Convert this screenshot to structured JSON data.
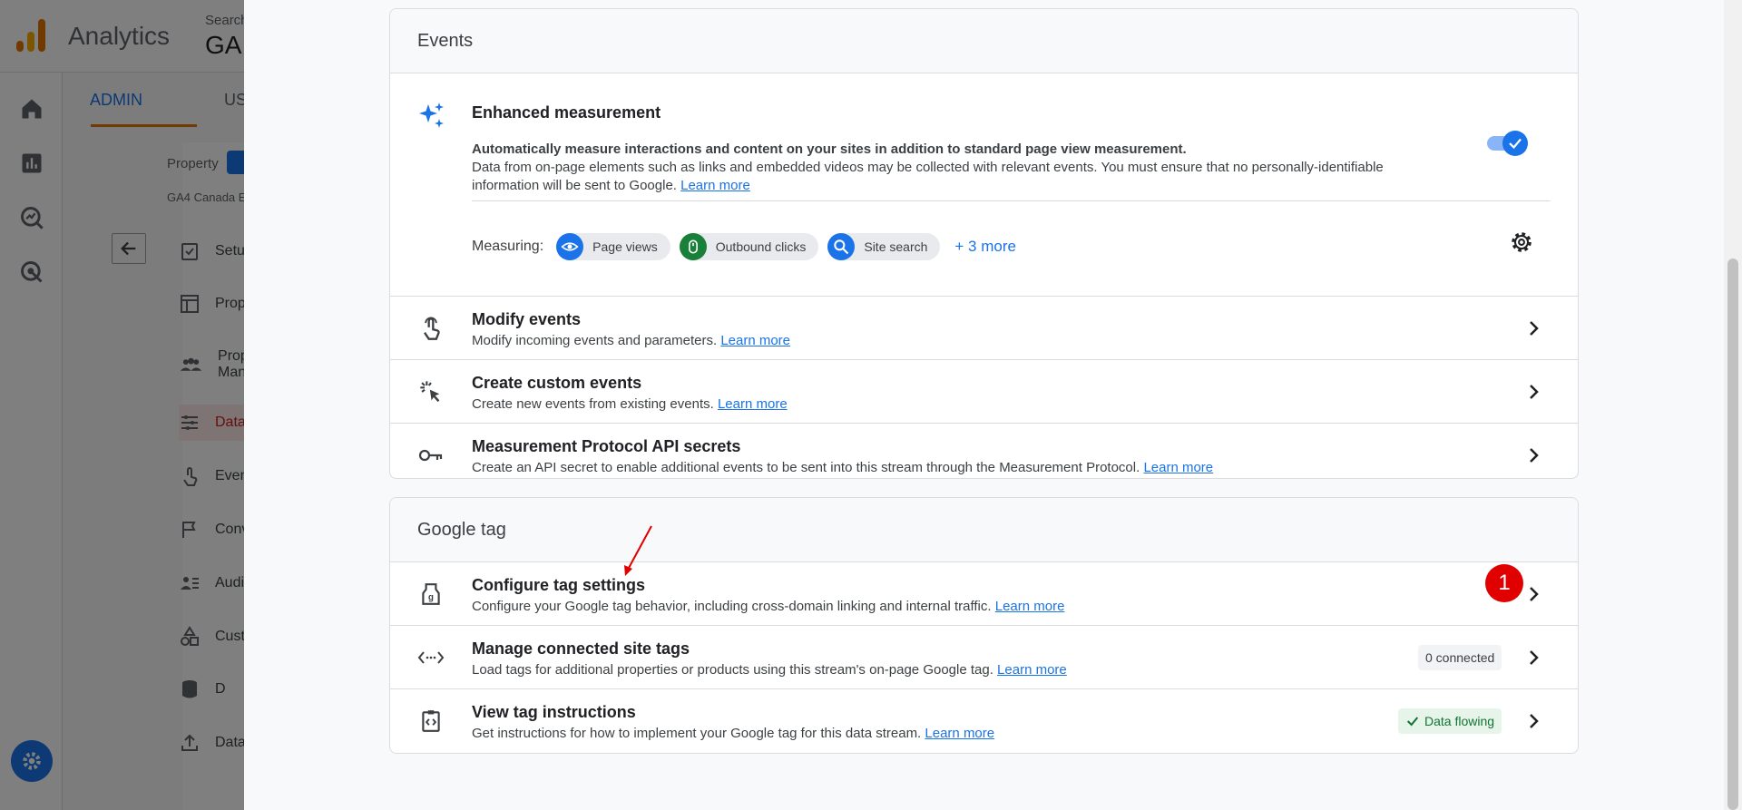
{
  "background": {
    "app_name": "Analytics",
    "search_hint": "Search",
    "search_title": "GA",
    "tabs": {
      "admin": "ADMIN",
      "user": "US"
    },
    "property_label": "Property",
    "property_name": "GA4 Canada E",
    "side_items": [
      {
        "label": "Setu",
        "icon": "checklist-icon"
      },
      {
        "label": "Prop",
        "icon": "layout-icon"
      },
      {
        "label": "Prop Man",
        "icon": "people-icon"
      },
      {
        "label": "Data",
        "icon": "data-streams-icon",
        "active": true
      },
      {
        "label": "Even",
        "icon": "touch-icon"
      },
      {
        "label": "Conv",
        "icon": "flag-icon"
      },
      {
        "label": "Audi",
        "icon": "audience-icon"
      },
      {
        "label": "Cust",
        "icon": "shapes-icon"
      },
      {
        "label": "D",
        "icon": "database-icon"
      },
      {
        "label": "Data",
        "icon": "upload-icon"
      }
    ]
  },
  "events_card": {
    "header": "Events",
    "enhanced": {
      "title": "Enhanced measurement",
      "bold_text": "Automatically measure interactions and content on your sites in addition to standard page view measurement.",
      "text": "Data from on-page elements such as links and embedded videos may be collected with relevant events. You must ensure that no personally-identifiable information will be sent to Google.",
      "link": "Learn more",
      "toggle_on": true,
      "measuring_label": "Measuring:",
      "chips": [
        {
          "label": "Page views",
          "icon": "eye-icon",
          "color": "#1a73e8"
        },
        {
          "label": "Outbound clicks",
          "icon": "mouse-icon",
          "color": "#188038"
        },
        {
          "label": "Site search",
          "icon": "search-icon",
          "color": "#1a73e8"
        }
      ],
      "more": "+ 3 more"
    },
    "rows": [
      {
        "title": "Modify events",
        "desc": "Modify incoming events and parameters.",
        "link": "Learn more",
        "icon": "touch-icon"
      },
      {
        "title": "Create custom events",
        "desc": "Create new events from existing events.",
        "link": "Learn more",
        "icon": "sparkle-cursor-icon"
      },
      {
        "title": "Measurement Protocol API secrets",
        "desc": "Create an API secret to enable additional events to be sent into this stream through the Measurement Protocol.",
        "link": "Learn more",
        "icon": "key-icon"
      }
    ]
  },
  "google_tag_card": {
    "header": "Google tag",
    "rows": [
      {
        "title": "Configure tag settings",
        "desc": "Configure your Google tag behavior, including cross-domain linking and internal traffic.",
        "link": "Learn more",
        "icon": "tag-icon"
      },
      {
        "title": "Manage connected site tags",
        "desc": "Load tags for additional properties or products using this stream's on-page Google tag.",
        "link": "Learn more",
        "icon": "code-arrows-icon",
        "badge": "0 connected"
      },
      {
        "title": "View tag instructions",
        "desc": "Get instructions for how to implement your Google tag for this data stream.",
        "link": "Learn more",
        "icon": "clipboard-code-icon",
        "status": "Data flowing"
      }
    ]
  },
  "annotation": {
    "step": "1",
    "color": "#e00000"
  }
}
